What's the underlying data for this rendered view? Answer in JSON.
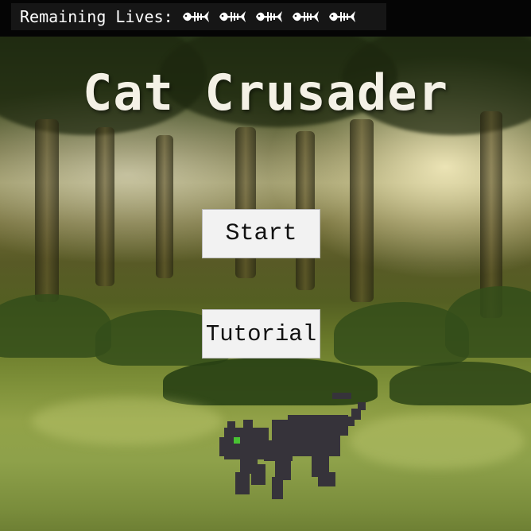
{
  "hud": {
    "label": "Remaining Lives:",
    "lives_count": 5,
    "life_icon": "fish-bone-icon"
  },
  "title": "Cat Crusader",
  "menu": {
    "start_label": "Start",
    "tutorial_label": "Tutorial"
  },
  "colors": {
    "hud_background": "#050505",
    "button_background": "#f2f2f2",
    "title_color": "#f4f1e6",
    "cat_color": "#36333a",
    "cat_eye": "#49c233"
  }
}
